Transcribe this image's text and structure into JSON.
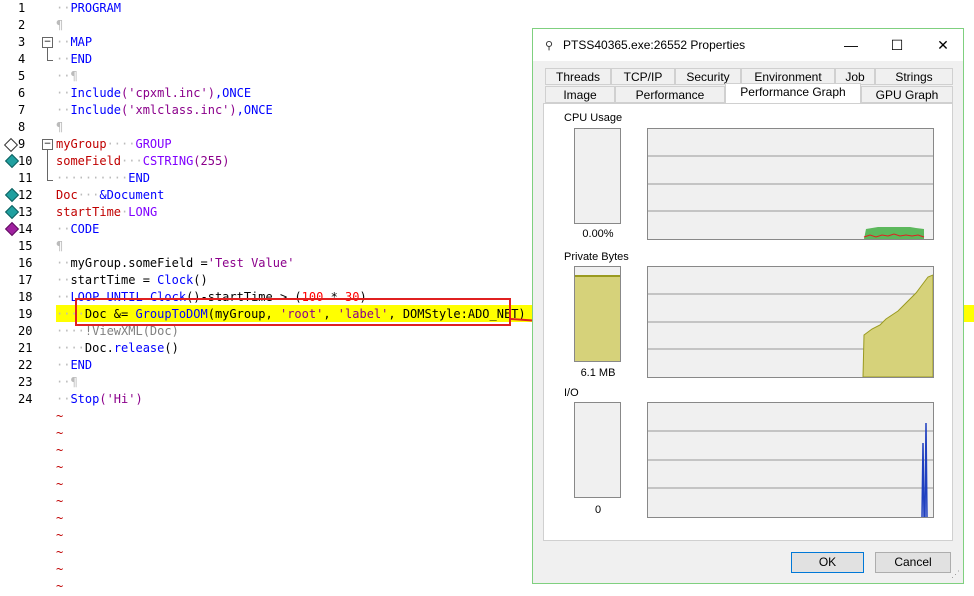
{
  "editor": {
    "line_numbers": [
      "1",
      "2",
      "3",
      "4",
      "5",
      "6",
      "7",
      "8",
      "9",
      "10",
      "11",
      "12",
      "13",
      "14",
      "15",
      "16",
      "17",
      "18",
      "19",
      "20",
      "21",
      "22",
      "23",
      "24"
    ],
    "lines": {
      "l1": "PROGRAM",
      "l3": "MAP",
      "l4": "END",
      "l6a": "Include",
      "l6b": "('cpxml.inc')",
      "l6c": ",ONCE",
      "l7a": "Include",
      "l7b": "('xmlclass.inc')",
      "l7c": ",ONCE",
      "l9a": "myGroup",
      "l9b": "GROUP",
      "l10a": "someField",
      "l10b": "CSTRING",
      "l10c": "(255)",
      "l11": "END",
      "l12a": "Doc",
      "l12b": "&Document",
      "l13a": "startTime",
      "l13b": "LONG",
      "l14": "CODE",
      "l16a": "myGroup.someField =",
      "l16b": "'Test Value'",
      "l17a": "startTime = ",
      "l17b": "Clock",
      "l17c": "()",
      "l18a": "LOOP UNTIL ",
      "l18b": "Clock",
      "l18c": "()-startTime > (",
      "l18d": "100",
      "l18e": " * ",
      "l18f": "30",
      "l18g": ")",
      "l19a": "Doc &= ",
      "l19b": "GroupToDOM",
      "l19c": "(myGroup, ",
      "l19d": "'root'",
      "l19e": ", ",
      "l19f": "'label'",
      "l19g": ", DOMStyle:ADO_NET)",
      "l20": "!ViewXML(Doc)",
      "l21a": "Doc.",
      "l21b": "release",
      "l21c": "()",
      "l22": "END",
      "l24a": "Stop",
      "l24b": "('Hi')"
    },
    "tilde": "~",
    "pilcrow": "¶"
  },
  "dialog": {
    "title": "PTSS40365.exe:26552 Properties",
    "tabs_row1": [
      "Threads",
      "TCP/IP",
      "Security",
      "Environment",
      "Job",
      "Strings"
    ],
    "tabs_row2": [
      "Image",
      "Performance",
      "Performance Graph",
      "GPU Graph"
    ],
    "active_tab": "Performance Graph",
    "sections": {
      "cpu": {
        "label": "CPU Usage",
        "value": "0.00%"
      },
      "private": {
        "label": "Private Bytes",
        "value": "6.1 MB"
      },
      "io": {
        "label": "I/O",
        "value": "0"
      }
    },
    "buttons": {
      "ok": "OK",
      "cancel": "Cancel"
    },
    "colors": {
      "accent_border": "#7fd07f",
      "graph_fill": "#d6d27a",
      "cpu_green": "#5cb85c",
      "io_blue": "#2040c0",
      "annotation_red": "#e02020"
    }
  }
}
